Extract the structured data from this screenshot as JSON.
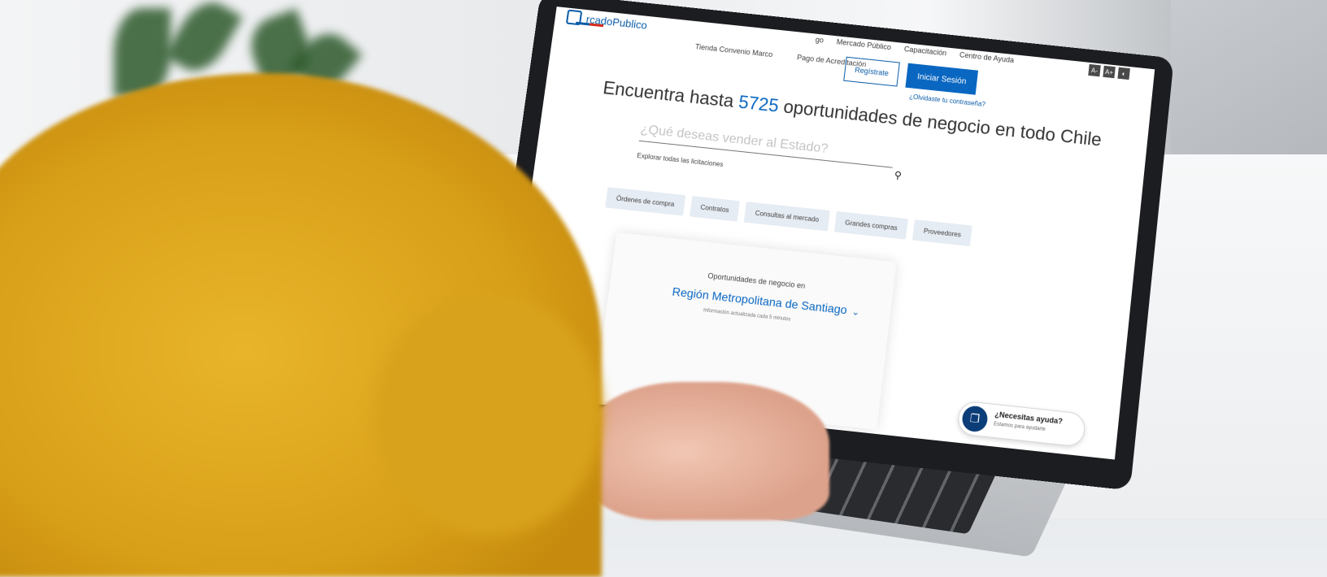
{
  "site": {
    "logo_text": "rcadoPublico"
  },
  "header": {
    "nav_links": [
      "go",
      "Mercado Público",
      "Capacitación",
      "Centro de Ayuda"
    ],
    "accessibility": [
      "A-",
      "A+",
      "◐"
    ],
    "sub_links": [
      "Tienda Convenio Marco",
      "Pago de Acreditación"
    ],
    "register_label": "Regístrate",
    "login_label": "Iniciar Sesión",
    "forgot_label": "¿Olvidaste tu contraseña?"
  },
  "hero": {
    "prefix": "Encuentra hasta",
    "count": "5725",
    "suffix": "oportunidades de negocio en todo Chile"
  },
  "search": {
    "placeholder": "¿Qué deseas vender al Estado?",
    "explore_label": "Explorar todas las licitaciones"
  },
  "chips": [
    "Órdenes de compra",
    "Contratos",
    "Consultas al mercado",
    "Grandes compras",
    "Proveedores"
  ],
  "region": {
    "intro": "Oportunidades de negocio en",
    "name": "Región Metropolitana de Santiago",
    "update_note": "Información actualizada cada 5 minutos"
  },
  "help": {
    "title": "¿Necesitas ayuda?",
    "subtitle": "Estamos para ayudarte"
  },
  "colors": {
    "brand_blue": "#0a67c1",
    "sweater": "#e0a820"
  }
}
